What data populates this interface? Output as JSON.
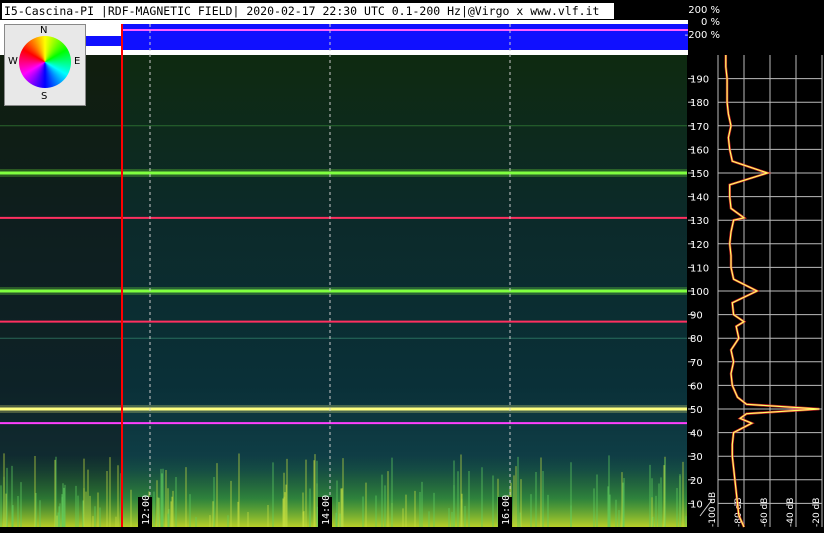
{
  "title": "I5-Cascina-PI |RDF-MAGNETIC FIELD| 2020-02-17 22:30 UTC 0.1-200 Hz|@Virgo x www.vlf.it",
  "compass": {
    "n": "N",
    "s": "S",
    "e": "E",
    "w": "W"
  },
  "direction_scale": [
    "200 %",
    "0 %",
    "-200 %"
  ],
  "colors": {
    "background": "#000000",
    "direction_band": "#1010ff",
    "cursor": "#ff0000",
    "grid": "#cccccc",
    "spectrum": "#ffff66"
  },
  "chart_data": [
    {
      "type": "heatmap",
      "title": "",
      "xlabel": "",
      "ylabel": "",
      "x_ticks": [
        "12:00",
        "14:00",
        "16:00"
      ],
      "y_range": [
        0,
        200
      ],
      "y_unit": "Hz",
      "horizontal_lines_hz": [
        {
          "freq": 50,
          "color": "#ffff80",
          "strength": "strong"
        },
        {
          "freq": 100,
          "color": "#80ff40",
          "strength": "strong"
        },
        {
          "freq": 150,
          "color": "#80ff40",
          "strength": "strong"
        },
        {
          "freq": 131,
          "color": "#ff3060",
          "strength": "medium"
        },
        {
          "freq": 87,
          "color": "#ff3060",
          "strength": "medium"
        },
        {
          "freq": 44,
          "color": "#ff40ff",
          "strength": "medium"
        },
        {
          "freq": 170,
          "color": "#40a040",
          "strength": "weak"
        },
        {
          "freq": 80,
          "color": "#40a080",
          "strength": "weak"
        }
      ],
      "grid": true
    },
    {
      "type": "line",
      "title": "",
      "xlabel": "",
      "ylabel": "",
      "x_ticks": [
        "-100 dB",
        "-80 dB",
        "-60 dB",
        "-40 dB",
        "-20 dB"
      ],
      "y_ticks": [
        10,
        20,
        30,
        40,
        50,
        60,
        70,
        80,
        90,
        100,
        110,
        120,
        130,
        140,
        150,
        160,
        170,
        180,
        190
      ],
      "xlim": [
        -100,
        -20
      ],
      "ylim": [
        0,
        200
      ],
      "series": [
        {
          "freq": [
            0,
            5,
            10,
            15,
            20,
            25,
            30,
            35,
            40,
            44,
            46,
            48,
            50,
            52,
            55,
            60,
            65,
            70,
            75,
            80,
            85,
            87,
            90,
            95,
            100,
            105,
            110,
            115,
            120,
            125,
            130,
            131,
            135,
            140,
            145,
            150,
            155,
            160,
            165,
            170,
            175,
            180,
            185,
            190,
            195,
            200
          ],
          "level_db": [
            -80,
            -84,
            -85,
            -86,
            -87,
            -88,
            -89,
            -89,
            -88,
            -74,
            -83,
            -78,
            -22,
            -78,
            -85,
            -89,
            -90,
            -88,
            -90,
            -84,
            -86,
            -80,
            -88,
            -89,
            -70,
            -88,
            -90,
            -90,
            -91,
            -90,
            -88,
            -80,
            -90,
            -91,
            -91,
            -62,
            -89,
            -91,
            -92,
            -90,
            -92,
            -93,
            -93,
            -93,
            -94,
            -94
          ]
        }
      ],
      "grid": true
    }
  ]
}
